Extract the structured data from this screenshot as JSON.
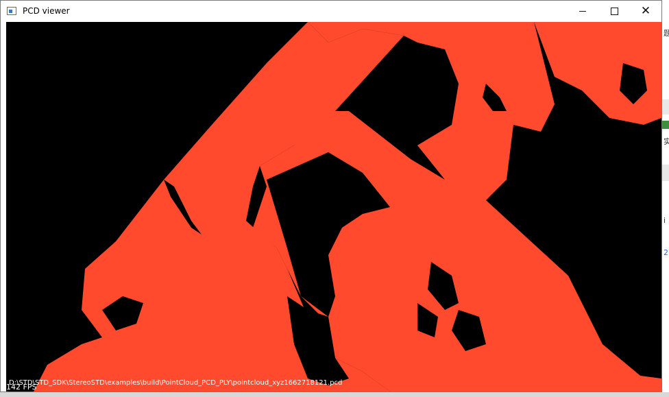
{
  "window": {
    "title": "PCD viewer",
    "icon": "app-window-icon",
    "controls": {
      "minimize_icon": "minimize-icon",
      "maximize_icon": "maximize-icon",
      "close_icon": "close-icon",
      "close_glyph": "✕"
    }
  },
  "viewer": {
    "background_color": "#000000",
    "point_color": "#ff4a2e",
    "fps_text": "142 FPS",
    "file_path": "D:\\STD\\STD_SDK\\StereoSTD\\examples\\build\\PointCloud_PCD_PLY\\pointcloud_xyz1662718121.pcd"
  },
  "background_app": {
    "glyphs": [
      "题",
      "实",
      "i",
      "2"
    ]
  }
}
